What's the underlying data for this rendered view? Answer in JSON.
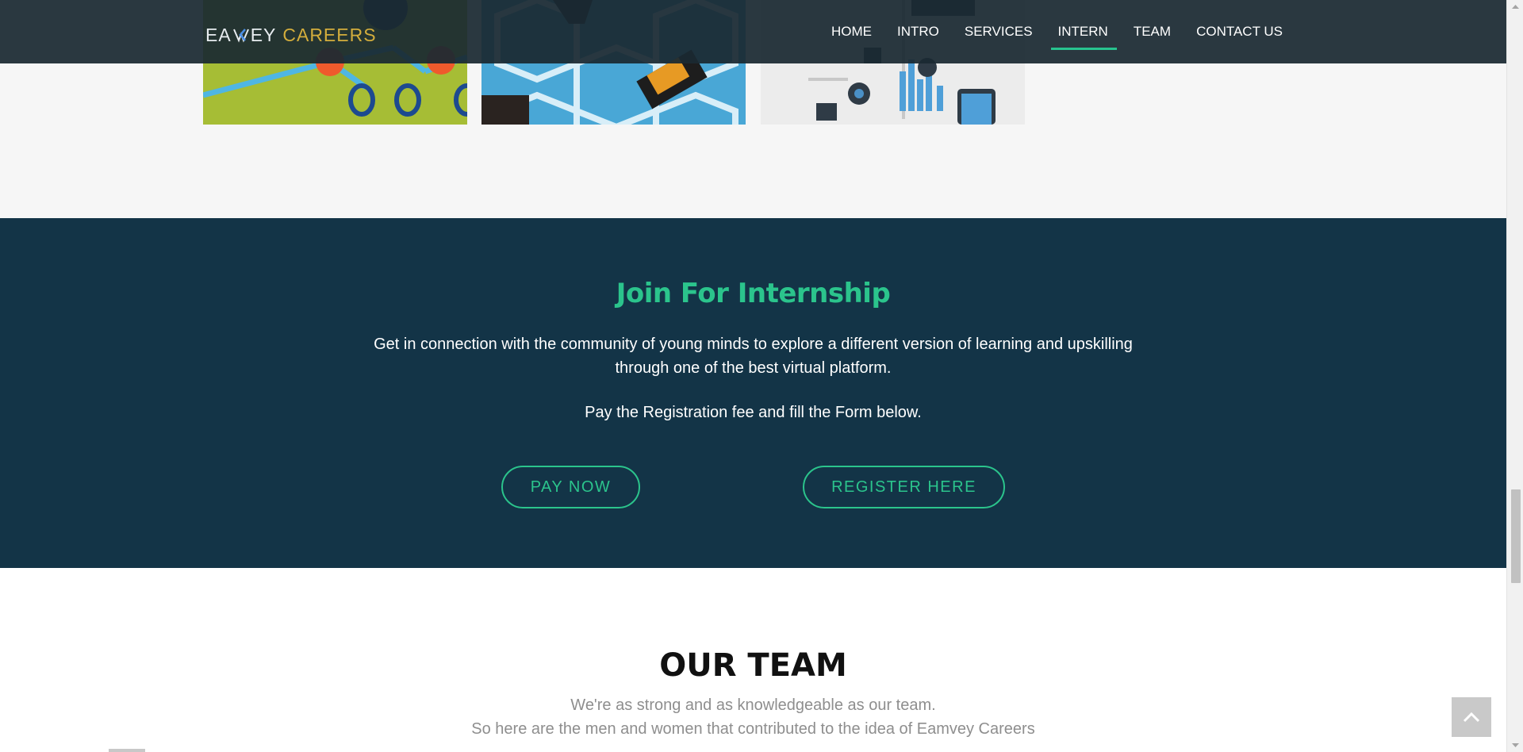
{
  "header": {
    "logo_part1": "EA",
    "logo_part2": "EY",
    "logo_part3": "CAREERS",
    "nav": [
      {
        "label": "HOME",
        "active": false
      },
      {
        "label": "INTRO",
        "active": false
      },
      {
        "label": "SERVICES",
        "active": false
      },
      {
        "label": "INTERN",
        "active": true
      },
      {
        "label": "TEAM",
        "active": false
      },
      {
        "label": "CONTACT US",
        "active": false
      }
    ]
  },
  "internship": {
    "title": "Join For Internship",
    "desc_line1": "Get in connection with the community of young minds to explore a different version of learning and upskilling",
    "desc_line2": "through one of the best virtual platform.",
    "note": "Pay the Registration fee and fill the Form below.",
    "pay_button": "PAY NOW",
    "register_button": "REGISTER HERE"
  },
  "team": {
    "title": "OUR TEAM",
    "sub_line1": "We're as strong and as knowledgeable as our team.",
    "sub_line2": "So here are the men and women that contributed to the idea of Eamvey Careers"
  },
  "colors": {
    "accent": "#2bc48c",
    "section_bg": "#133447",
    "header_bg": "#1a2932",
    "logo_gold": "#d3ad3c"
  },
  "icons": {
    "back_to_top": "chevron-up-icon"
  }
}
